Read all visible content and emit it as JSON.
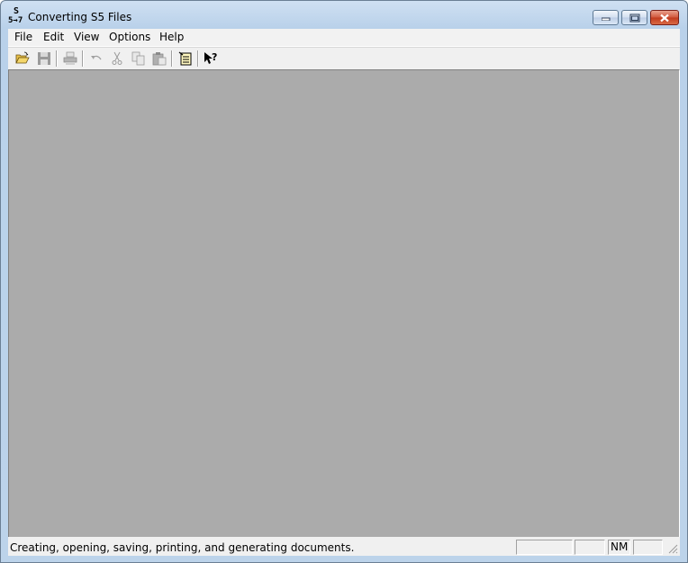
{
  "window": {
    "title": "Converting S5 Files",
    "app_icon_text_top": "S",
    "app_icon_text_bottom": "5→7"
  },
  "menu": [
    {
      "label": "File"
    },
    {
      "label": "Edit"
    },
    {
      "label": "View"
    },
    {
      "label": "Options"
    },
    {
      "label": "Help"
    }
  ],
  "toolbar": {
    "buttons": [
      {
        "icon": "open-folder-icon",
        "enabled": true
      },
      {
        "icon": "save-icon",
        "enabled": false
      },
      {
        "icon": "print-icon",
        "enabled": false
      },
      {
        "icon": "undo-icon",
        "enabled": false
      },
      {
        "icon": "cut-icon",
        "enabled": false
      },
      {
        "icon": "copy-icon",
        "enabled": false
      },
      {
        "icon": "paste-icon",
        "enabled": false
      },
      {
        "icon": "properties-icon",
        "enabled": true
      },
      {
        "icon": "context-help-icon",
        "enabled": true
      }
    ]
  },
  "status": {
    "message": "Creating, opening, saving, printing, and generating documents.",
    "panes": [
      "",
      "",
      "NM",
      ""
    ]
  },
  "colors": {
    "mdi_background": "#ababab",
    "close_button": "#c13a1d",
    "title_frame": "#b9d1ea"
  }
}
